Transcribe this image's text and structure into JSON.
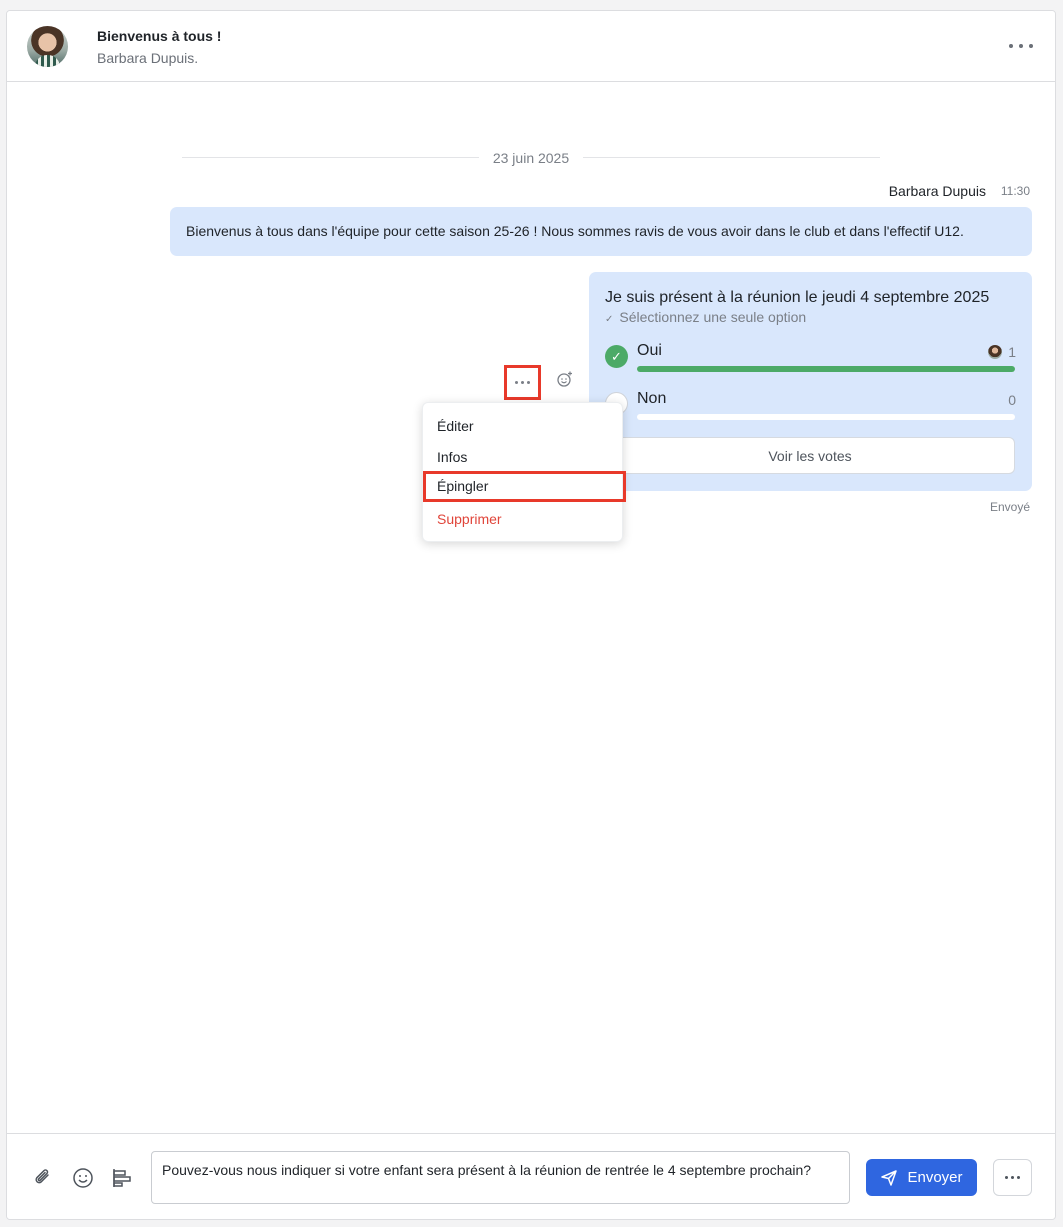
{
  "header": {
    "title": "Bienvenus à tous !",
    "subtitle": "Barbara Dupuis.",
    "more_icon": "more-horizontal-icon"
  },
  "feed": {
    "date_separator": "23 juin 2025",
    "message": {
      "sender": "Barbara Dupuis",
      "time": "11:30",
      "text": "Bienvenus à tous dans l'équipe pour cette saison 25-26 ! Nous sommes ravis de vous avoir dans le club et dans l'effectif U12."
    },
    "poll": {
      "question": "Je suis présent à la réunion le jeudi 4 septembre 2025",
      "hint": "Sélectionnez une seule option",
      "options": [
        {
          "label": "Oui",
          "count": "1",
          "fill": 1.0,
          "selected": true
        },
        {
          "label": "Non",
          "count": "0",
          "fill": 0.0,
          "selected": false
        }
      ],
      "votes_button": "Voir les votes",
      "status": "Envoyé"
    }
  },
  "context_menu": {
    "items": [
      "Éditer",
      "Infos",
      "Épingler",
      "Supprimer"
    ]
  },
  "composer": {
    "text": "Pouvez-vous nous indiquer si votre enfant sera présent à la réunion de rentrée le 4 septembre prochain?",
    "send_label": "Envoyer"
  },
  "colors": {
    "accent": "#2f66e0",
    "bubble": "#d9e7fc",
    "success": "#4caa67",
    "danger": "#e0453a",
    "highlight": "#e8392a"
  }
}
